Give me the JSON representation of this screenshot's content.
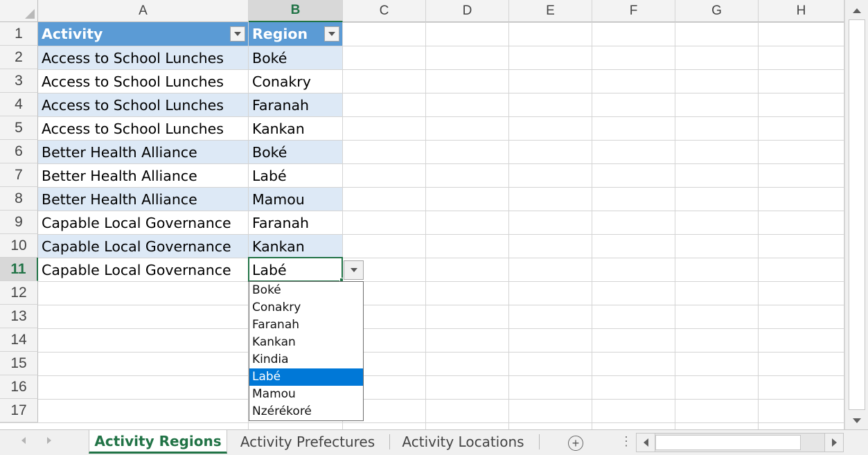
{
  "columns": [
    "A",
    "B",
    "C",
    "D",
    "E",
    "F",
    "G",
    "H"
  ],
  "selected_column": "B",
  "rows": [
    "1",
    "2",
    "3",
    "4",
    "5",
    "6",
    "7",
    "8",
    "9",
    "10",
    "11",
    "12",
    "13",
    "14",
    "15",
    "16",
    "17"
  ],
  "selected_row": "11",
  "table": {
    "headers": [
      "Activity",
      "Region"
    ],
    "data": [
      [
        "Access to School Lunches",
        "Boké"
      ],
      [
        "Access to School Lunches",
        "Conakry"
      ],
      [
        "Access to School Lunches",
        "Faranah"
      ],
      [
        "Access to School Lunches",
        "Kankan"
      ],
      [
        "Better Health Alliance",
        "Boké"
      ],
      [
        "Better Health Alliance",
        "Labé"
      ],
      [
        "Better Health Alliance",
        "Mamou"
      ],
      [
        "Capable Local Governance",
        "Faranah"
      ],
      [
        "Capable Local Governance",
        "Kankan"
      ],
      [
        "Capable Local Governance",
        "Labé"
      ]
    ]
  },
  "dropdown": {
    "options": [
      "Boké",
      "Conakry",
      "Faranah",
      "Kankan",
      "Kindia",
      "Labé",
      "Mamou",
      "Nzérékoré"
    ],
    "highlighted": "Labé"
  },
  "sheets": {
    "tabs": [
      "Activity Regions",
      "Activity Prefectures",
      "Activity Locations"
    ],
    "active": "Activity Regions",
    "add_label": "+",
    "more_label": "⋮"
  },
  "colors": {
    "header_fill": "#5b9bd5",
    "band_fill": "#dde9f6",
    "selection": "#217346",
    "dropdown_highlight": "#0078d7"
  }
}
